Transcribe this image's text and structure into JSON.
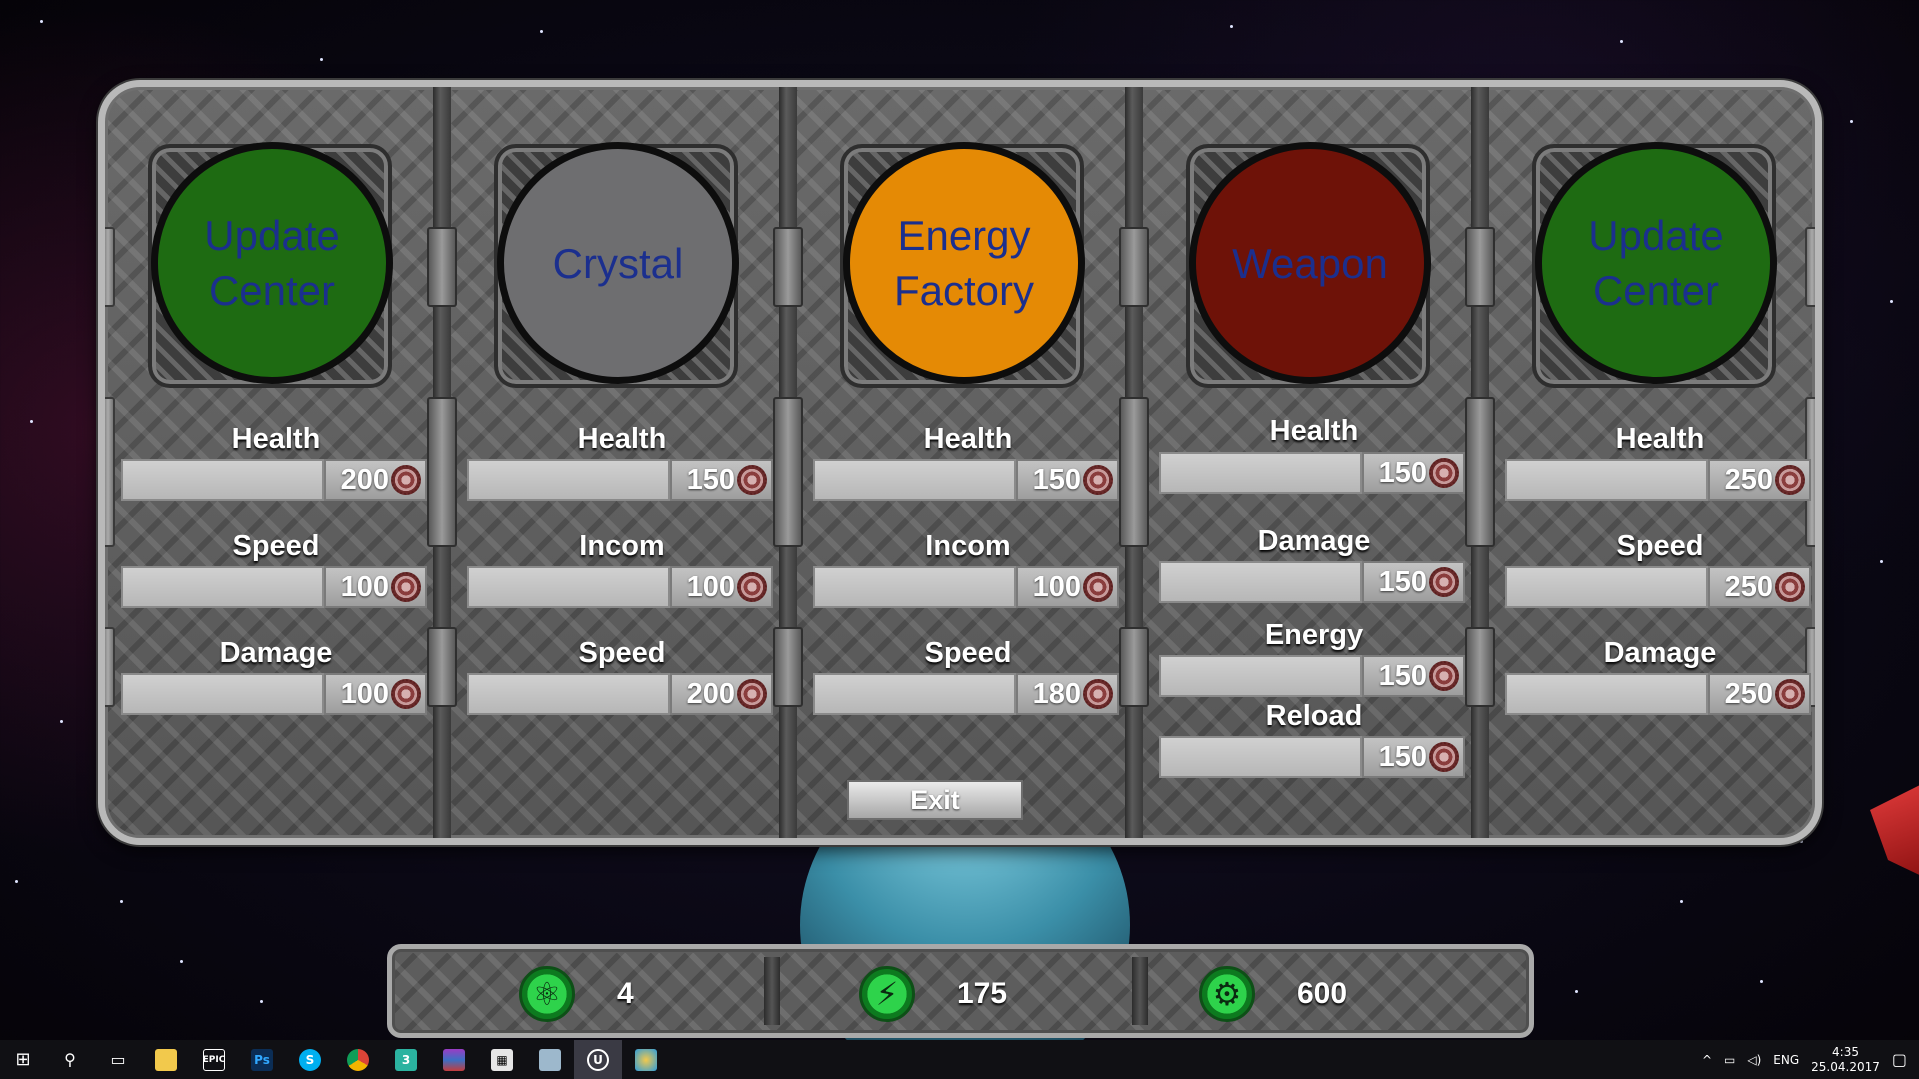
{
  "colors": {
    "green_badge": "#1e6b12",
    "gray_badge": "#6e6e70",
    "orange_badge": "#e58a05",
    "red_badge": "#6e1208",
    "badge_text": "#1b2f8e",
    "resource_icon": "#2ed34b"
  },
  "columns": [
    {
      "badge_lines": [
        "Update",
        "Center"
      ],
      "badge_color": "green",
      "stats": [
        {
          "label": "Health",
          "value": "200"
        },
        {
          "label": "Speed",
          "value": "100"
        },
        {
          "label": "Damage",
          "value": "100"
        }
      ]
    },
    {
      "badge_lines": [
        "Crystal"
      ],
      "badge_color": "gray",
      "stats": [
        {
          "label": "Health",
          "value": "150"
        },
        {
          "label": "Incom",
          "value": "100"
        },
        {
          "label": "Speed",
          "value": "200"
        }
      ]
    },
    {
      "badge_lines": [
        "Energy",
        "Factory"
      ],
      "badge_color": "orange",
      "stats": [
        {
          "label": "Health",
          "value": "150"
        },
        {
          "label": "Incom",
          "value": "100"
        },
        {
          "label": "Speed",
          "value": "180"
        }
      ]
    },
    {
      "badge_lines": [
        "Weapon"
      ],
      "badge_color": "red",
      "stats": [
        {
          "label": "Health",
          "value": "150"
        },
        {
          "label": "Damage",
          "value": "150"
        },
        {
          "label": "Energy",
          "value": "150"
        },
        {
          "label": "Reload",
          "value": "150"
        }
      ]
    },
    {
      "badge_lines": [
        "Update",
        "Center"
      ],
      "badge_color": "green",
      "stats": [
        {
          "label": "Health",
          "value": "250"
        },
        {
          "label": "Speed",
          "value": "250"
        },
        {
          "label": "Damage",
          "value": "250"
        }
      ]
    }
  ],
  "exit_label": "Exit",
  "resources": [
    {
      "icon": "atom-icon",
      "value": "4"
    },
    {
      "icon": "lightning-icon",
      "value": "175"
    },
    {
      "icon": "gear-icon",
      "value": "600"
    }
  ],
  "taskbar": {
    "icons": [
      "windows-start-icon",
      "search-icon",
      "task-view-icon",
      "file-explorer-icon",
      "epic-games-icon",
      "photoshop-icon",
      "skype-icon",
      "chrome-icon",
      "app-3-icon",
      "winrar-icon",
      "calculator-icon",
      "explorer-window-icon",
      "unreal-engine-icon",
      "paint-icon"
    ],
    "ps_label": "Ps",
    "epic_label": "EPIC",
    "three_label": "3",
    "ue_label": "U",
    "lang": "ENG",
    "time": "4:35",
    "date": "25.04.2017"
  }
}
